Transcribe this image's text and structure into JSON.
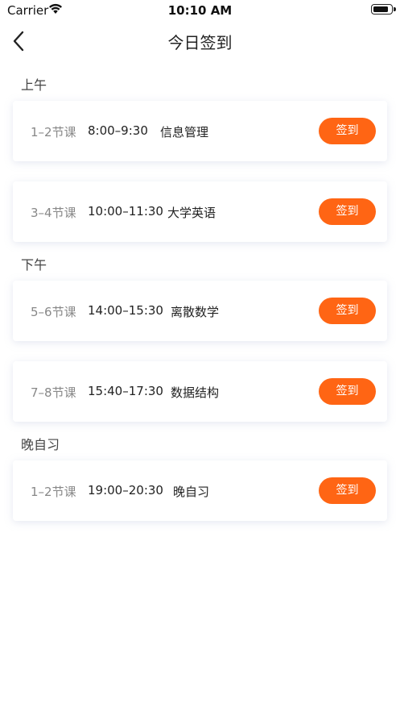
{
  "status_bar": {
    "carrier": "Carrier",
    "time": "10:10 AM",
    "battery_level": 0.9
  },
  "nav": {
    "back_icon": "chevron-left-icon",
    "title": "今日签到"
  },
  "colors": {
    "accent": "#ff6514"
  },
  "sections": [
    {
      "label": "上午",
      "items": [
        {
          "period": "1–2节课",
          "time": "8:00–9:30",
          "course": "信息管理",
          "button": "签到"
        },
        {
          "period": "3–4节课",
          "time": "10:00–11:30",
          "course": "大学英语",
          "button": "签到"
        }
      ]
    },
    {
      "label": "下午",
      "items": [
        {
          "period": "5–6节课",
          "time": "14:00–15:30",
          "course": "离散数学",
          "button": "签到"
        },
        {
          "period": "7–8节课",
          "time": "15:40–17:30",
          "course": "数据结构",
          "button": "签到"
        }
      ]
    },
    {
      "label": "晚自习",
      "items": [
        {
          "period": "1–2节课",
          "time": "19:00–20:30",
          "course": "晚自习",
          "button": "签到"
        }
      ]
    }
  ]
}
